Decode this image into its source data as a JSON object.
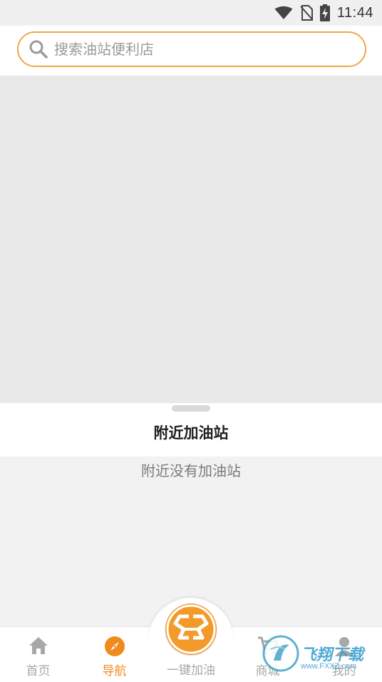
{
  "status_bar": {
    "time": "11:44",
    "icons": [
      "wifi-icon",
      "no-sim-icon",
      "battery-charging-icon"
    ]
  },
  "search": {
    "placeholder": "搜索油站便利店",
    "value": "",
    "accent_color": "#f2a54a"
  },
  "sheet": {
    "title": "附近加油站",
    "empty_message": "附近没有加油站"
  },
  "bottom_nav": {
    "active_color": "#f08a1c",
    "items": [
      {
        "label": "首页",
        "icon": "home-icon",
        "active": false
      },
      {
        "label": "导航",
        "icon": "compass-icon",
        "active": true
      },
      {
        "label": "一键加油",
        "icon": "refuel-logo-icon",
        "active": false
      },
      {
        "label": "商城",
        "icon": "cart-icon",
        "active": false
      },
      {
        "label": "我的",
        "icon": "profile-icon",
        "active": false
      }
    ]
  },
  "watermark": {
    "text": "飞翔下载",
    "url": "www.FXXZ.com"
  }
}
